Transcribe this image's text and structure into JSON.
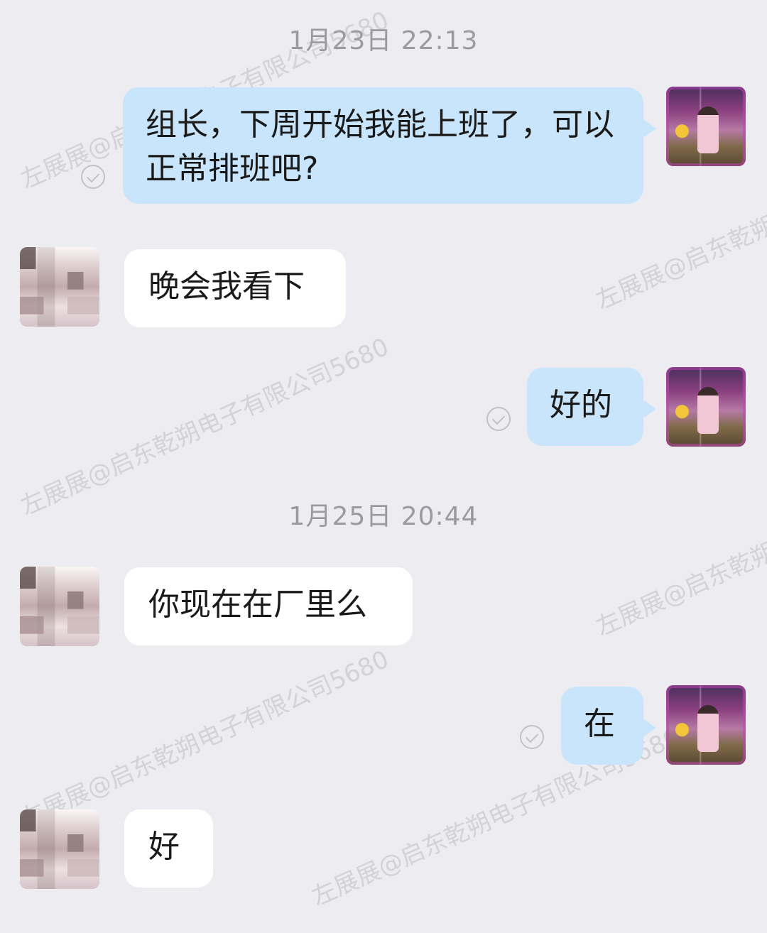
{
  "messages": [
    {
      "type": "time",
      "text": "1月23日  22:13"
    },
    {
      "type": "self",
      "text": "组长，下周开始我能上班了，可以正常排班吧?"
    },
    {
      "type": "other",
      "text": "晚会我看下"
    },
    {
      "type": "self",
      "text": "好的"
    },
    {
      "type": "time",
      "text": "1月25日  20:44"
    },
    {
      "type": "other",
      "text": "你现在在厂里么"
    },
    {
      "type": "self",
      "text": "在"
    },
    {
      "type": "other",
      "text": "好"
    }
  ],
  "watermark": "左展展@启东乾朔电子有限公司5680",
  "colors": {
    "background": "#ededf1",
    "self_bubble": "#c9e5fb",
    "other_bubble": "#ffffff",
    "timestamp": "#9a9aa0"
  }
}
